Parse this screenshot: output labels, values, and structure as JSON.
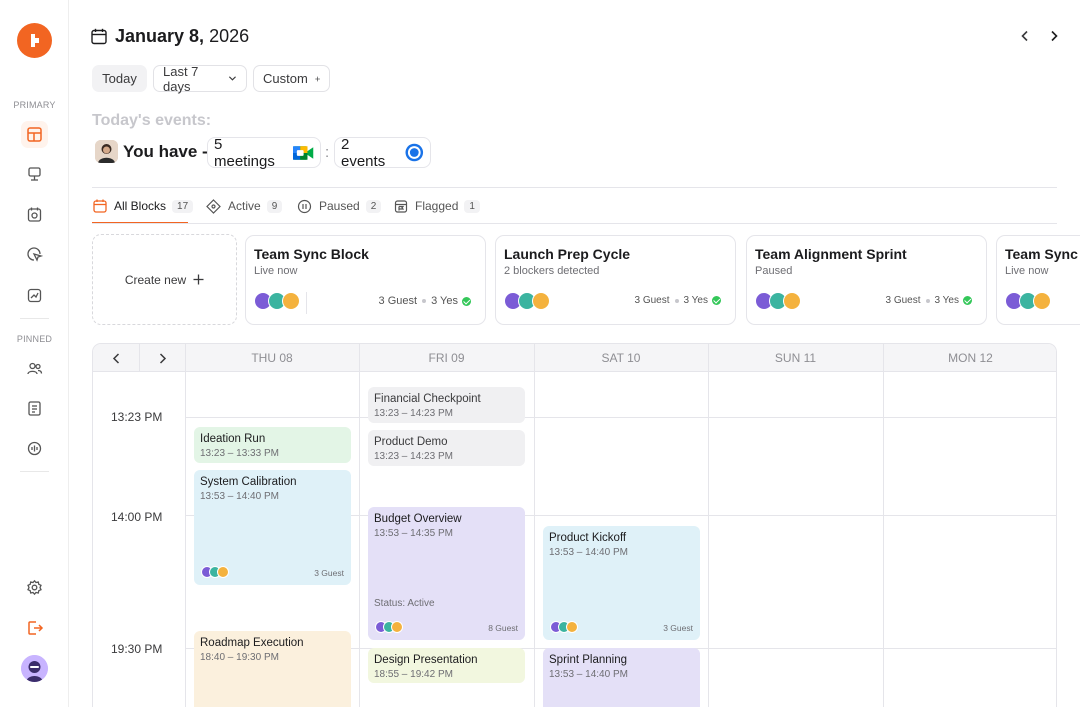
{
  "sidebar": {
    "primary_label": "PRIMARY",
    "pinned_label": "PINNED",
    "primary_items": [
      "dashboard-icon",
      "presentation-icon",
      "calendar-clock-icon",
      "cursor-click-icon",
      "trend-chart-icon"
    ],
    "pinned_items": [
      "users-icon",
      "notebook-icon",
      "ai-chip-icon"
    ],
    "bottom_items": [
      "settings-icon",
      "logout-icon"
    ]
  },
  "header": {
    "date_bold": "January 8,",
    "date_year": " 2026"
  },
  "filters": {
    "today": "Today",
    "last7": "Last 7 days",
    "custom": "Custom"
  },
  "summary": {
    "label": "Today's events:",
    "you_have": "You have -",
    "meetings": "5 meetings",
    "separator": ":",
    "events": "2 events"
  },
  "tabs": [
    {
      "label": "All Blocks",
      "count": "17"
    },
    {
      "label": "Active",
      "count": "9"
    },
    {
      "label": "Paused",
      "count": "2"
    },
    {
      "label": "Flagged",
      "count": "1"
    }
  ],
  "create_new": "Create new",
  "blocks": [
    {
      "title": "Team Sync Block",
      "status": "Live now",
      "guests": "3 Guest",
      "yes": "3 Yes"
    },
    {
      "title": "Launch Prep Cycle",
      "status": "2 blockers detected",
      "guests": "3 Guest",
      "yes": "3 Yes"
    },
    {
      "title": "Team Alignment Sprint",
      "status": "Paused",
      "guests": "3 Guest",
      "yes": "3 Yes"
    },
    {
      "title": "Team Sync Block",
      "status": "Live now",
      "guests": "",
      "yes": ""
    }
  ],
  "calendar": {
    "days": [
      "THU 08",
      "FRI 09",
      "SAT 10",
      "SUN 11",
      "MON 12"
    ],
    "times": [
      "13:23 PM",
      "14:00 PM",
      "19:30 PM"
    ],
    "events": {
      "ideation": {
        "title": "Ideation Run",
        "time": "13:23 – 13:33 PM"
      },
      "calibration": {
        "title": "System Calibration",
        "time": "13:53 – 14:40 PM",
        "guests": "3 Guest"
      },
      "roadmap": {
        "title": "Roadmap Execution",
        "time": "18:40 – 19:30 PM"
      },
      "financial": {
        "title": "Financial Checkpoint",
        "time": "13:23 – 14:23 PM"
      },
      "demo": {
        "title": "Product Demo",
        "time": "13:23 – 14:23 PM"
      },
      "budget": {
        "title": "Budget Overview",
        "time": "13:53 – 14:35 PM",
        "status": "Status: Active",
        "guests": "8 Guest"
      },
      "design": {
        "title": "Design Presentation",
        "time": "18:55 – 19:42 PM"
      },
      "kickoff": {
        "title": "Product Kickoff",
        "time": "13:53 – 14:40 PM",
        "guests": "3 Guest"
      },
      "sprint": {
        "title": "Sprint Planning",
        "time": "13:53 – 14:40 PM"
      }
    }
  },
  "colors": {
    "accent": "#f26522",
    "success": "#34c759",
    "event_green": "#e3f5e6",
    "event_blue": "#dff1f8",
    "event_gray": "#f0f0f2",
    "event_purple": "#e4e0f7",
    "event_peach": "#fbf0dd",
    "event_lime": "#f2f7df"
  }
}
